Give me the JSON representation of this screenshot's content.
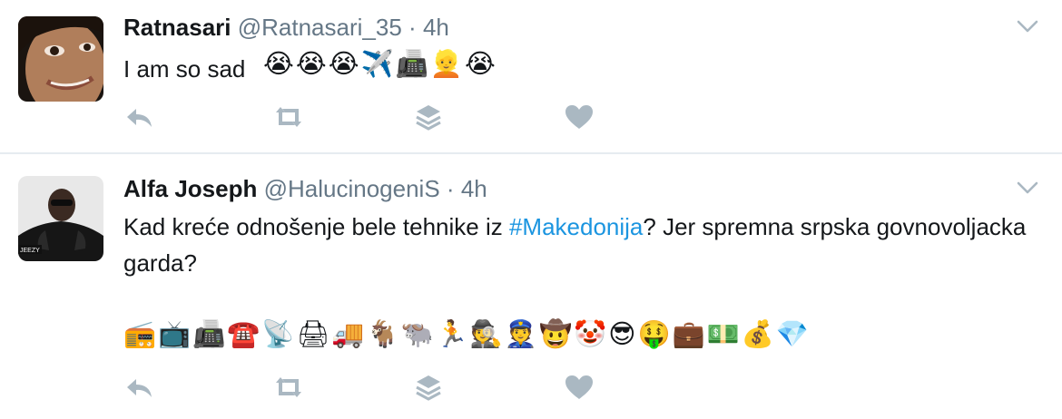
{
  "colors": {
    "text": "#14171a",
    "secondary": "#657786",
    "link": "#1b95e0",
    "icon": "#aab8c2",
    "divider": "#e6ecf0"
  },
  "tweets": [
    {
      "name": "Ratnasari",
      "handle": "@Ratnasari_35",
      "separator": "·",
      "time": "4h",
      "text": "I am so sad",
      "emojis": "😭😭😭✈️📠👱😭",
      "icons": [
        "reply-icon",
        "retweet-icon",
        "layers-icon",
        "heart-icon",
        "chevron-down-icon"
      ]
    },
    {
      "name": "Alfa Joseph",
      "handle": "@HalucinogeniS",
      "separator": "·",
      "time": "4h",
      "text_before": "Kad kreće odnošenje bele tehnike iz ",
      "hashtag": "#Makedonija",
      "text_after": "? Jer spremna srpska govnovoljacka garda?",
      "emojis": "📻📺📠☎️📡🖨🚚🐐🐃🏃🕵👮🤠🤡😎🤑💼💵💰💎",
      "avatar_watermark": "JEEZY",
      "icons": [
        "reply-icon",
        "retweet-icon",
        "layers-icon",
        "heart-icon",
        "chevron-down-icon"
      ]
    }
  ]
}
